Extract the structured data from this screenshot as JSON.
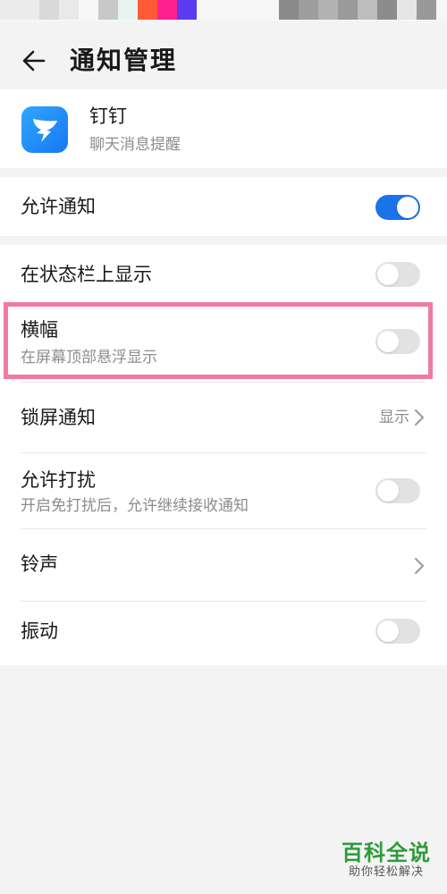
{
  "header": {
    "title": "通知管理",
    "back_icon": "arrow-left-icon"
  },
  "app": {
    "name": "钉钉",
    "description": "聊天消息提醒",
    "icon": "dingtalk-logo-icon"
  },
  "settings": {
    "allow_notifications": {
      "label": "允许通知",
      "enabled": true
    },
    "status_bar": {
      "label": "在状态栏上显示",
      "enabled": false
    },
    "banner": {
      "label": "横幅",
      "description": "在屏幕顶部悬浮显示",
      "enabled": false
    },
    "lock_screen": {
      "label": "锁屏通知",
      "value": "显示"
    },
    "allow_dnd": {
      "label": "允许打扰",
      "description": "开启免打扰后，允许继续接收通知",
      "enabled": false
    },
    "ringtone": {
      "label": "铃声"
    },
    "vibration": {
      "label": "振动",
      "enabled": false
    }
  },
  "colors": {
    "toggle_on": "#1a73e8",
    "toggle_off": "#e2e2e2",
    "highlight": "#f07aa0",
    "watermark": "#2e9b3a"
  },
  "watermark": {
    "title": "百科全说",
    "subtitle": "助你轻松解决"
  }
}
